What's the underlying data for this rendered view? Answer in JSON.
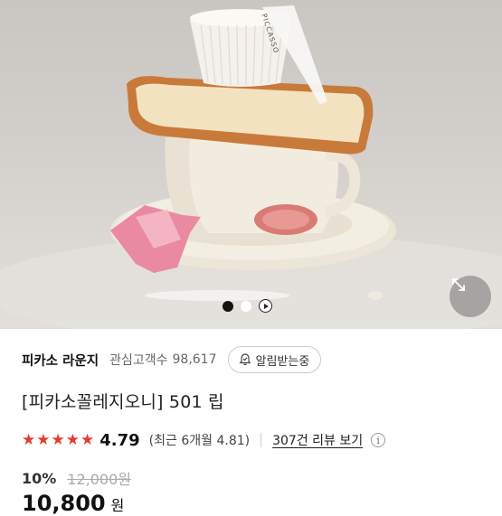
{
  "gallery": {
    "indicator_count": 2,
    "active_index": 0,
    "has_play_control": true,
    "packaging_text": "PICCASSO"
  },
  "seller": {
    "name": "피카소 라운지",
    "favorites_label": "관심고객수",
    "favorites_count": "98,617",
    "notify_label": "알림받는중"
  },
  "product": {
    "title": "[피카소꼴레지오니] 501 립"
  },
  "rating": {
    "stars": 5,
    "score": "4.79",
    "recent_text": "(최근 6개월 4.81)",
    "reviews_link": "307건 리뷰 보기"
  },
  "price": {
    "discount": "10%",
    "original": "12,000원",
    "final": "10,800",
    "currency": "원"
  },
  "colors": {
    "star": "#e63a2e",
    "active_dot": "#111111"
  }
}
